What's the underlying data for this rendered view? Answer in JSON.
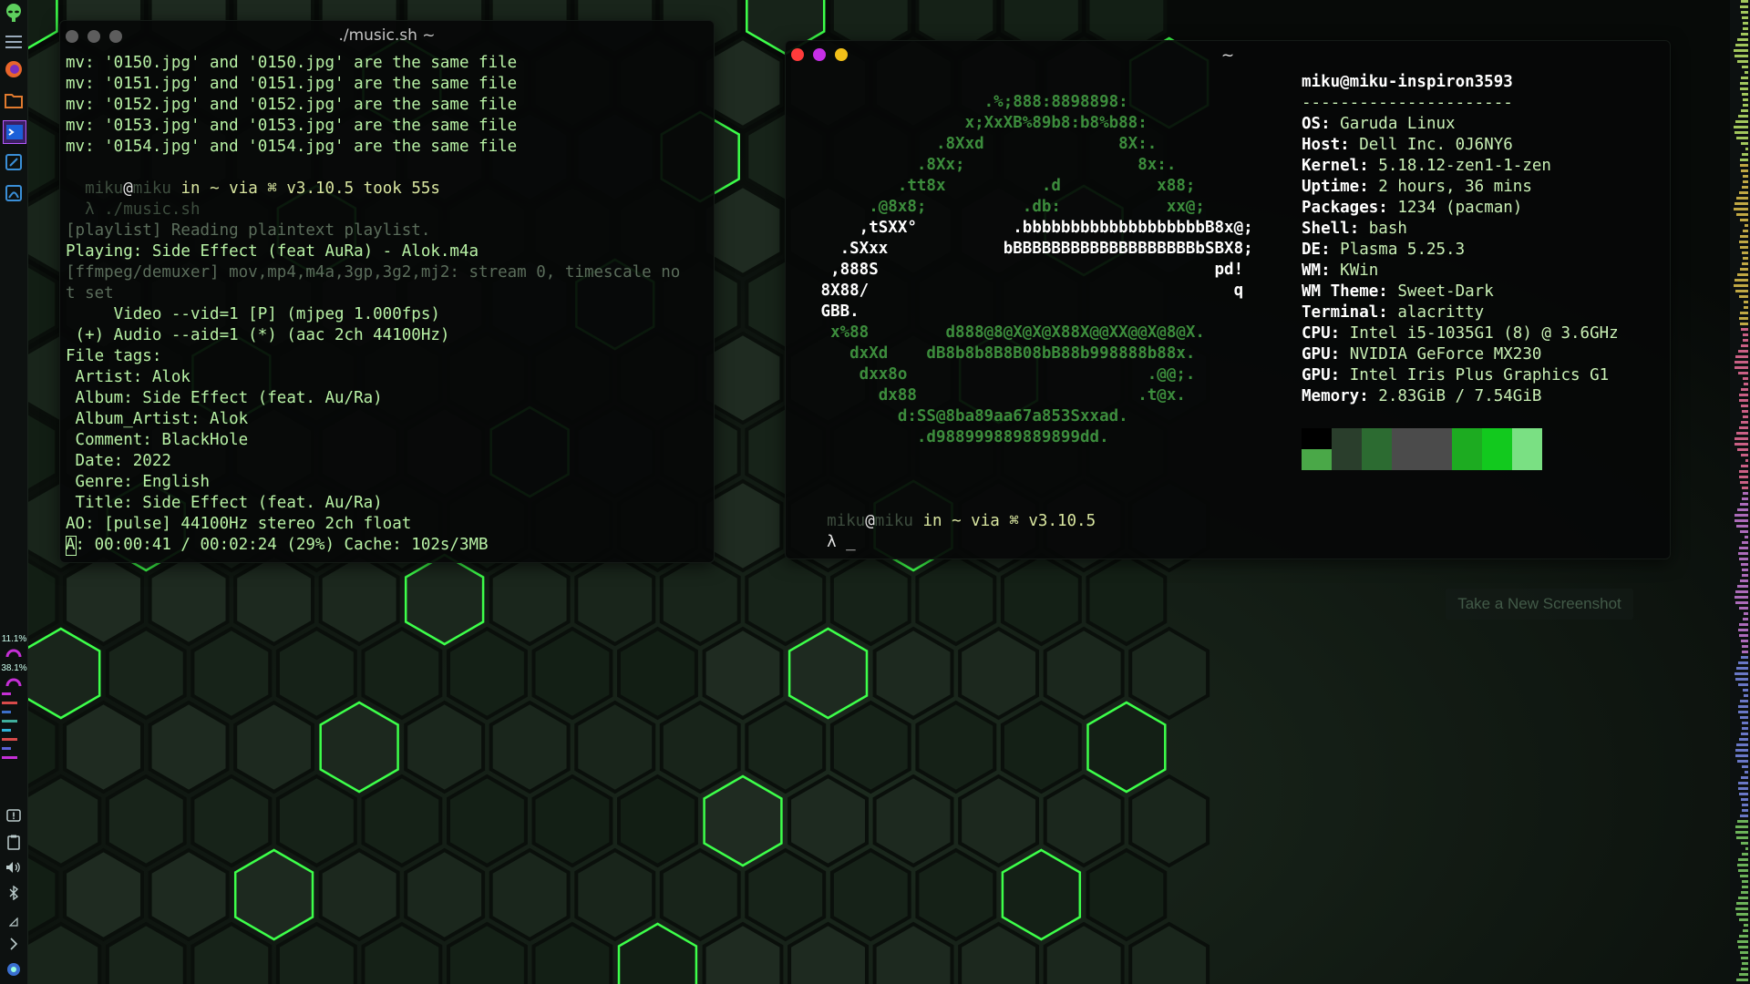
{
  "music_terminal": {
    "title": "./music.sh ~",
    "lines": [
      {
        "text": "mv: '0150.jpg' and '0150.jpg' are the same file",
        "cls": "g"
      },
      {
        "text": "mv: '0151.jpg' and '0151.jpg' are the same file",
        "cls": "g"
      },
      {
        "text": "mv: '0152.jpg' and '0152.jpg' are the same file",
        "cls": "g"
      },
      {
        "text": "mv: '0153.jpg' and '0153.jpg' are the same file",
        "cls": "g"
      },
      {
        "text": "mv: '0154.jpg' and '0154.jpg' are the same file",
        "cls": "g"
      },
      {
        "text": "",
        "cls": "g"
      },
      {
        "text": "PROMPT1",
        "cls": "prompt"
      },
      {
        "text": "  λ ./music.sh",
        "cls": "dark"
      },
      {
        "text": "[playlist] Reading plaintext playlist.",
        "cls": "dim"
      },
      {
        "text": "Playing: Side Effect (feat AuRa) - Alok.m4a",
        "cls": "g"
      },
      {
        "text": "[ffmpeg/demuxer] mov,mp4,m4a,3gp,3g2,mj2: stream 0, timescale no",
        "cls": "dim"
      },
      {
        "text": "t set",
        "cls": "dim"
      },
      {
        "text": "     Video --vid=1 [P] (mjpeg 1.000fps)",
        "cls": "g"
      },
      {
        "text": " (+) Audio --aid=1 (*) (aac 2ch 44100Hz)",
        "cls": "g"
      },
      {
        "text": "File tags:",
        "cls": "g"
      },
      {
        "text": " Artist: Alok",
        "cls": "g"
      },
      {
        "text": " Album: Side Effect (feat. Au/Ra)",
        "cls": "g"
      },
      {
        "text": " Album_Artist: Alok",
        "cls": "g"
      },
      {
        "text": " Comment: BlackHole",
        "cls": "g"
      },
      {
        "text": " Date: 2022",
        "cls": "g"
      },
      {
        "text": " Genre: English",
        "cls": "g"
      },
      {
        "text": " Title: Side Effect (feat. Au/Ra)",
        "cls": "g"
      },
      {
        "text": "AO: [pulse] 44100Hz stereo 2ch float",
        "cls": "g"
      },
      {
        "text": "A: 00:00:41 / 00:02:24 (29%) Cache: 102s/3MB",
        "cls": "g"
      }
    ],
    "prompt": {
      "user": "miku",
      "host": "miku",
      "rest": " in ~ via ⌘ v3.10.5 took 55s"
    }
  },
  "neofetch_terminal": {
    "title": "~",
    "art": [
      "                  .%;888:8898898:",
      "                x;XxXB%89b8:b8%b88:",
      "             .8Xxd              8X:.",
      "           .8Xx;                  8x:.",
      "         .tt8x          .d          x88;",
      "      .@8x8;          .db:           xx@;",
      "     ,tSXX°          .bbbbbbbbbbbbbbbbbbbB8x@;",
      "   .SXxx            bBBBBBBBBBBBBBBBBBBBbSBX8;",
      "  ,888S                                   pd!",
      " 8X88/                                      q",
      " GBB.",
      "  x%88        d888@8@X@X@X88X@@XX@@X@8@X.",
      "    dxXd    dB8b8b8B8B08bB88b998888b88x.",
      "     dxx8o                         .@@;.",
      "       dx88                       .t@x.",
      "         d:SS@8ba89aa67a853Sxxad.",
      "           .d988999889889899dd."
    ],
    "header_user": "miku@miku-inspiron3593",
    "separator": "----------------------",
    "info": [
      {
        "key": "OS",
        "value": "Garuda Linux"
      },
      {
        "key": "Host",
        "value": "Dell Inc. 0J6NY6"
      },
      {
        "key": "Kernel",
        "value": "5.18.12-zen1-1-zen"
      },
      {
        "key": "Uptime",
        "value": "2 hours, 36 mins"
      },
      {
        "key": "Packages",
        "value": "1234 (pacman)"
      },
      {
        "key": "Shell",
        "value": "bash"
      },
      {
        "key": "DE",
        "value": "Plasma 5.25.3"
      },
      {
        "key": "WM",
        "value": "KWin"
      },
      {
        "key": "WM Theme",
        "value": "Sweet-Dark"
      },
      {
        "key": "Terminal",
        "value": "alacritty"
      },
      {
        "key": "CPU",
        "value": "Intel i5-1035G1 (8) @ 3.6GHz"
      },
      {
        "key": "GPU",
        "value": "NVIDIA GeForce MX230"
      },
      {
        "key": "GPU",
        "value": "Intel Iris Plus Graphics G1"
      },
      {
        "key": "Memory",
        "value": "2.83GiB / 7.54GiB"
      }
    ],
    "swatches_top": [
      "#000000",
      "#2a3e2c",
      "#2c6b31",
      "#4b4b4b",
      "#4b4b4b",
      "#1dab21",
      "#12c91e",
      "#7ae083"
    ],
    "swatches_bottom": [
      "#4aa848",
      "#2a3e2c",
      "#2c6b31",
      "#4b4b4b",
      "#4b4b4b",
      "#1dab21",
      "#12c91e",
      "#7ae083"
    ],
    "prompt": {
      "user": "miku",
      "host": "miku",
      "rest": " in ~ via ⌘ v3.10.5"
    },
    "cursor": "λ _"
  },
  "screenshot_button": "Take a New Screenshot",
  "left_panel": {
    "cpu_percent_label": "11.1%",
    "mem_percent_label": "38.1%",
    "icons": [
      "alien-icon",
      "menu-icon",
      "firefox-icon",
      "folder-icon",
      "terminal-icon",
      "editor-icon",
      "pdf-icon"
    ],
    "tray_icons": [
      "notification-icon",
      "clipboard-icon",
      "volume-icon",
      "bluetooth-icon",
      "network-icon",
      "chevron-icon",
      "shield-icon"
    ]
  },
  "colors": {
    "accent_green": "#3dff4a",
    "close_red": "#ff3b3b",
    "minimize_purple": "#c72fe6",
    "maximize_yellow": "#f3c019"
  }
}
